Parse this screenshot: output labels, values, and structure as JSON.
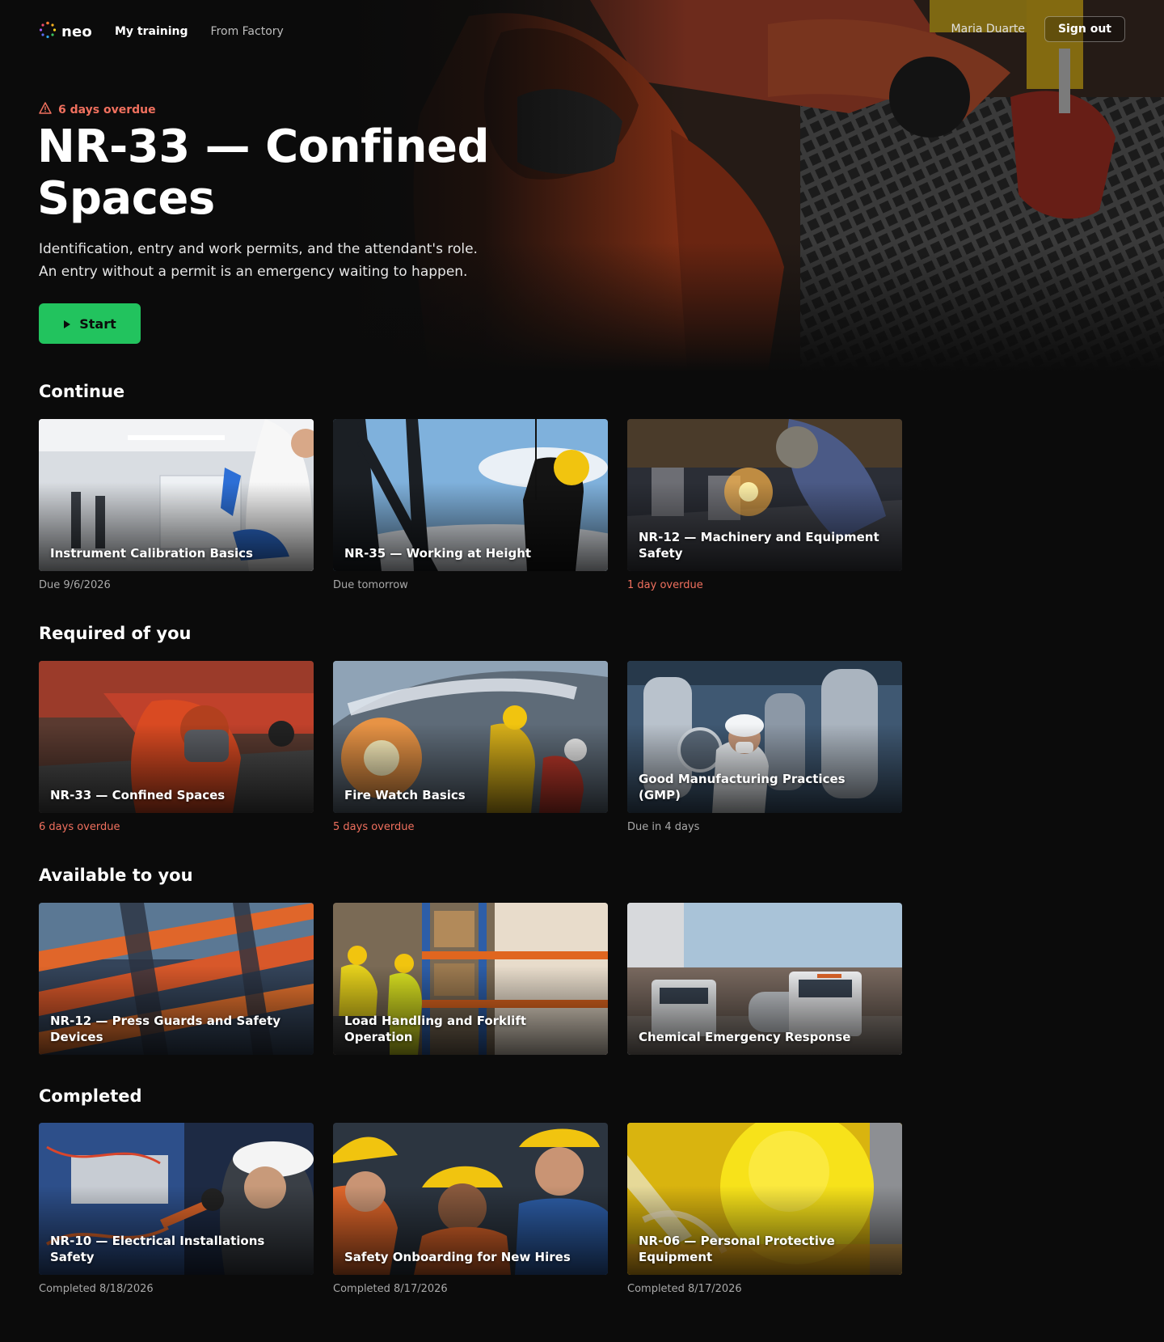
{
  "nav": {
    "logo_text": "neo",
    "links": [
      {
        "label": "My training",
        "active": true
      },
      {
        "label": "From Factory",
        "active": false
      }
    ],
    "user_name": "Maria Duarte",
    "signout_label": "Sign out"
  },
  "hero": {
    "alert_icon": "warning-triangle-icon",
    "alert_text": "6 days overdue",
    "title_line1": "NR-33 — Confined",
    "title_line2": "Spaces",
    "description": "Identification, entry and work permits, and the attendant's role. An entry without a permit is an emergency waiting to happen.",
    "start_label": "Start",
    "start_icon": "play-icon"
  },
  "sections": {
    "continue": {
      "title": "Continue",
      "cards": [
        {
          "title": "Instrument Calibration Basics",
          "meta": "Due 9/6/2026",
          "overdue": false
        },
        {
          "title": "NR-35 — Working at Height",
          "meta": "Due tomorrow",
          "overdue": false
        },
        {
          "title": "NR-12 — Machinery and Equipment Safety",
          "meta": "1 day overdue",
          "overdue": true
        }
      ]
    },
    "required": {
      "title": "Required of you",
      "cards": [
        {
          "title": "NR-33 — Confined Spaces",
          "meta": "6 days overdue",
          "overdue": true
        },
        {
          "title": "Fire Watch Basics",
          "meta": "5 days overdue",
          "overdue": true
        },
        {
          "title": "Good Manufacturing Practices (GMP)",
          "meta": "Due in 4 days",
          "overdue": false
        }
      ]
    },
    "available": {
      "title": "Available to you",
      "cards": [
        {
          "title": "NR-12 — Press Guards and Safety Devices"
        },
        {
          "title": "Load Handling and Forklift Operation"
        },
        {
          "title": "Chemical Emergency Response"
        }
      ]
    },
    "completed": {
      "title": "Completed",
      "cards": [
        {
          "title": "NR-10 — Electrical Installations Safety",
          "meta": "Completed 8/18/2026"
        },
        {
          "title": "Safety Onboarding for New Hires",
          "meta": "Completed 8/17/2026"
        },
        {
          "title": "NR-06 — Personal Protective Equipment",
          "meta": "Completed 8/17/2026"
        }
      ]
    }
  },
  "colors": {
    "background": "#0b0b0b",
    "accent_green": "#22c35e",
    "overdue": "#f0705e",
    "muted": "#a9a9a9"
  }
}
